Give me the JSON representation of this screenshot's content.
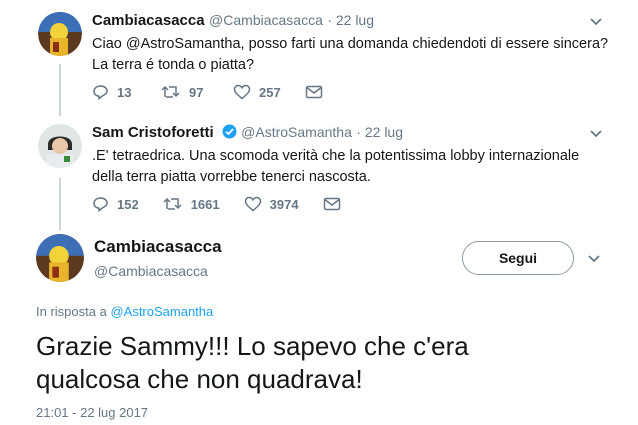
{
  "tweet1": {
    "name": "Cambiacasacca",
    "handle": "@Cambiacasacca",
    "time": "· 22 lug",
    "line1": "Ciao @AstroSamantha, posso farti una domanda chiedendoti di essere sincera?",
    "line2": "La terra é tonda o piatta?",
    "replies": "13",
    "retweets": "97",
    "likes": "257"
  },
  "tweet2": {
    "name": "Sam Cristoforetti",
    "handle": "@AstroSamantha",
    "time": "· 22 lug",
    "line1": ".E' tetraedrica. Una scomoda verità che la potentissima lobby internazionale",
    "line2": "della terra piatta vorrebbe tenerci nascosta.",
    "replies": "152",
    "retweets": "1661",
    "likes": "3974"
  },
  "main": {
    "name": "Cambiacasacca",
    "handle": "@Cambiacasacca",
    "follow_label": "Segui",
    "reply_prefix": "In risposta a",
    "reply_to": "@AstroSamantha",
    "line1": "Grazie Sammy!!! Lo sapevo che c'era",
    "line2": "qualcosa che non quadrava!",
    "timestamp": "21:01 - 22 lug 2017"
  },
  "colors": {
    "text": "#14171a",
    "muted": "#657786",
    "link": "#1da1f2",
    "verified": "#1da1f2",
    "line": "#ccd6dd"
  }
}
